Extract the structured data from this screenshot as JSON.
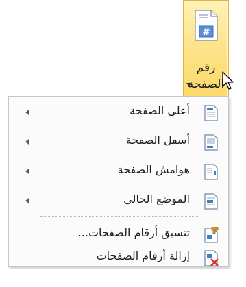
{
  "ribbon_button": {
    "label_line1": "رقم",
    "label_line2": "الصفحة",
    "icon": "page-number-document-icon",
    "icon_glyph": "#"
  },
  "menu": {
    "items": [
      {
        "label": "أعلى الصفحة",
        "icon": "page-top-icon",
        "has_submenu": true
      },
      {
        "label": "أسفل الصفحة",
        "icon": "page-bottom-icon",
        "has_submenu": true
      },
      {
        "label": "هوامش الصفحة",
        "icon": "page-margins-icon",
        "has_submenu": true
      },
      {
        "label": "الموضع الحالي",
        "icon": "current-position-icon",
        "has_submenu": true
      },
      {
        "label": "تنسيق أرقام الصفحات...",
        "icon": "format-page-numbers-icon",
        "has_submenu": false
      },
      {
        "label": "إزالة أرقام الصفحات",
        "icon": "remove-page-numbers-icon",
        "has_submenu": false
      }
    ]
  },
  "colors": {
    "ribbon_highlight": "#fde48c",
    "ribbon_border": "#e3b047",
    "icon_blue": "#3f7fc4",
    "remove_red": "#d9342b"
  }
}
